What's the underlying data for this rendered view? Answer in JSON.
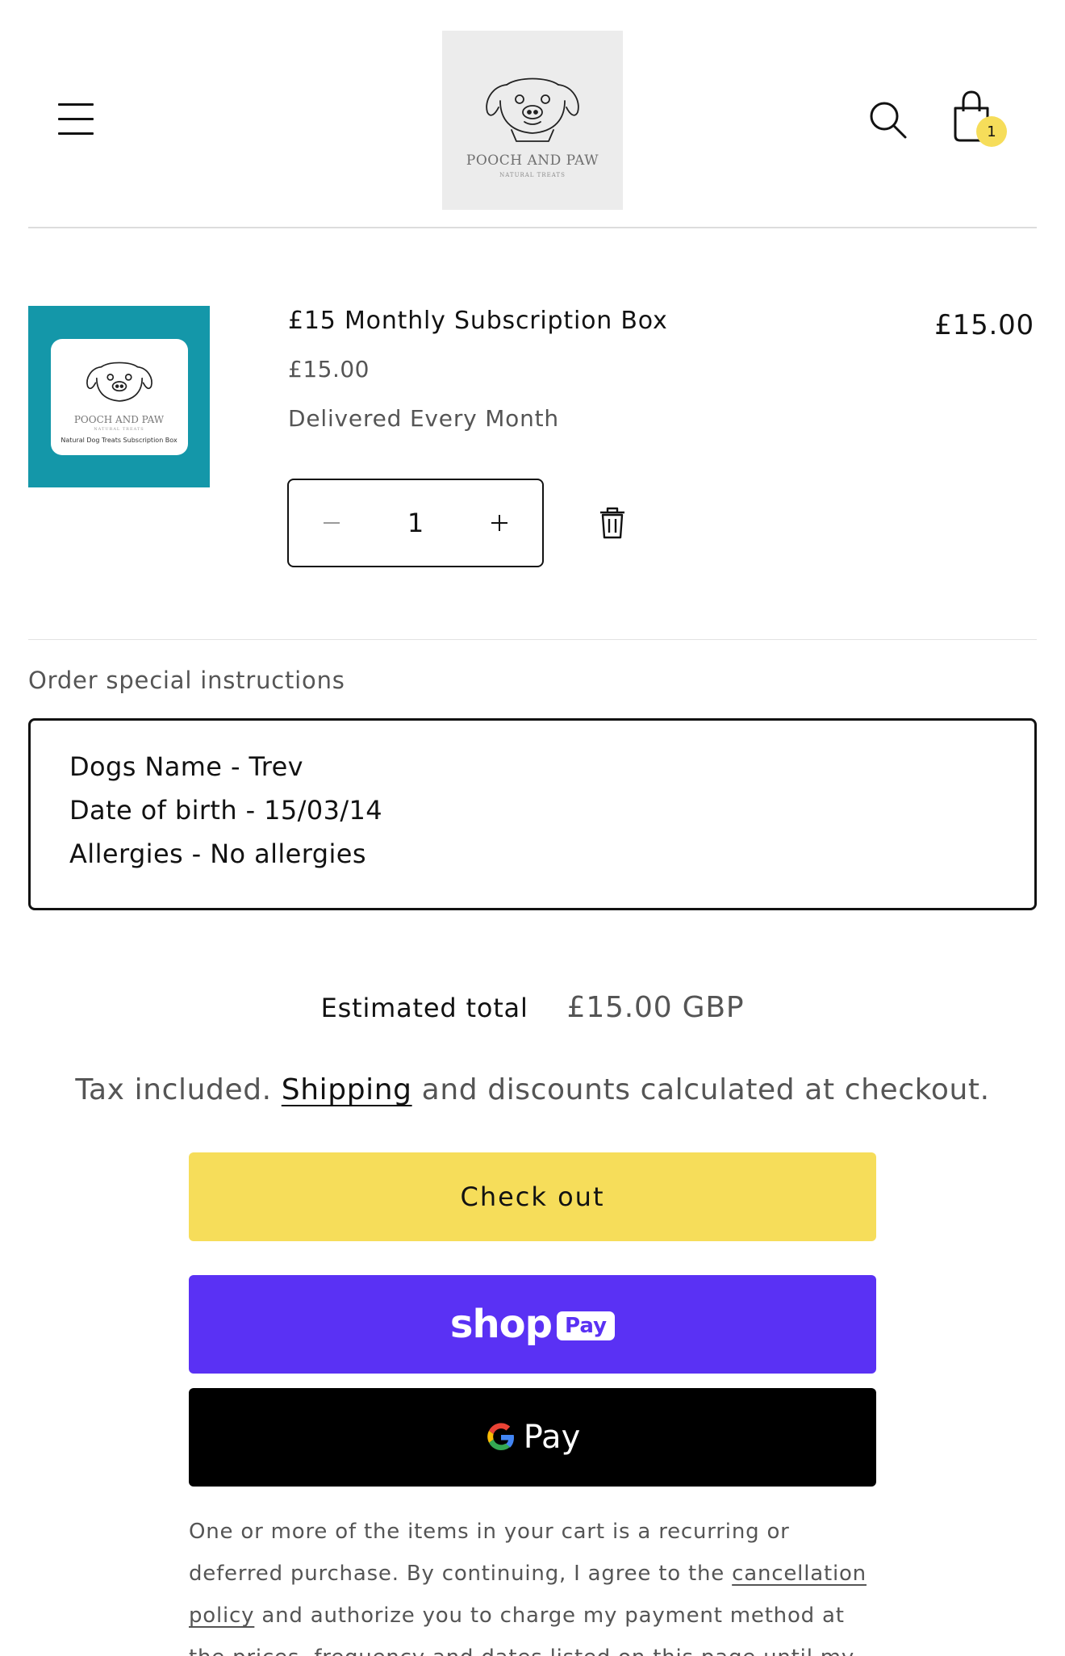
{
  "header": {
    "logo_text": "POOCH AND PAW",
    "logo_subtext": "NATURAL TREATS",
    "cart_count": "1"
  },
  "cart_item": {
    "title": "£15 Monthly Subscription Box",
    "unit_price": "£15.00",
    "plan": "Delivered Every Month",
    "line_price": "£15.00",
    "quantity": "1",
    "image_brand": "POOCH AND PAW",
    "image_subtext": "NATURAL TREATS",
    "image_caption": "Natural Dog Treats Subscription Box",
    "image_bg": "#1497a9"
  },
  "instructions": {
    "label": "Order special instructions",
    "lines": [
      "Dogs Name - Trev",
      "Date of birth - 15/03/14",
      "Allergies - No allergies"
    ]
  },
  "totals": {
    "label": "Estimated total",
    "value": "£15.00 GBP"
  },
  "tax_note": {
    "prefix": "Tax included. ",
    "link": "Shipping",
    "suffix": " and discounts calculated at checkout."
  },
  "buttons": {
    "checkout": "Check out",
    "shop_pay_word": "shop",
    "shop_pay_tag": "Pay",
    "gpay_word": "Pay"
  },
  "legal": {
    "part1": "One or more of the items in your cart is a recurring or deferred purchase. By continuing, I agree to the ",
    "link": "cancellation policy",
    "part2": " and authorize you to charge my payment method at the prices, frequency and dates listed on this page until my order is fulfilled or"
  },
  "colors": {
    "accent_yellow": "#f6dd5a",
    "shop_pay_purple": "#5a31f4",
    "gpay_black": "#000000"
  }
}
